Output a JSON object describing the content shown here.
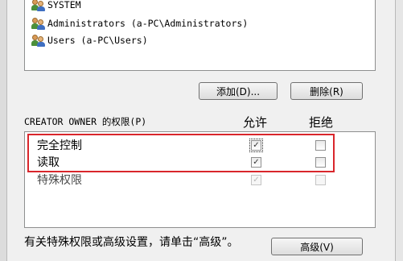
{
  "principals": [
    {
      "name": "SYSTEM",
      "icon": "users-icon"
    },
    {
      "name": "Administrators (a-PC\\Administrators)",
      "icon": "users-icon"
    },
    {
      "name": "Users (a-PC\\Users)",
      "icon": "users-icon"
    }
  ],
  "buttons": {
    "add": "添加(D)...",
    "remove": "删除(R)",
    "advanced": "高级(V)"
  },
  "permissions": {
    "caption": "CREATOR OWNER 的权限(P)",
    "allow_header": "允许",
    "deny_header": "拒绝",
    "rows": [
      {
        "name": "完全控制",
        "allow": true,
        "deny": false,
        "enabled": true
      },
      {
        "name": "读取",
        "allow": true,
        "deny": false,
        "enabled": true
      },
      {
        "name": "特殊权限",
        "allow": true,
        "deny": false,
        "enabled": false
      }
    ]
  },
  "hint": "有关特殊权限或高级设置，请单击“高级”。",
  "colors": {
    "highlight": "#d9262c"
  }
}
